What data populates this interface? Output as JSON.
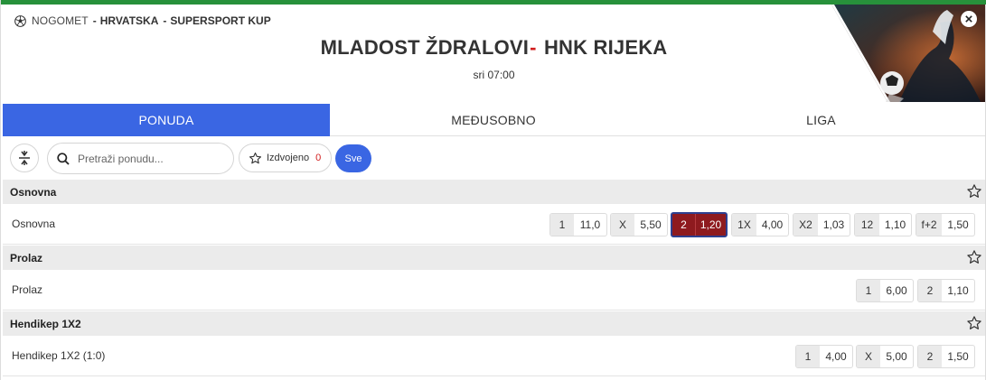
{
  "breadcrumb": {
    "sport": "NOGOMET",
    "country": "HRVATSKA",
    "competition": "SUPERSPORT KUP",
    "separator": "-"
  },
  "match": {
    "home": "MLADOST ŽDRALOVI",
    "dash": "-",
    "away": "HNK RIJEKA",
    "time": "sri 07:00"
  },
  "tabs": [
    {
      "label": "PONUDA",
      "active": true
    },
    {
      "label": "MEĐUSOBNO",
      "active": false
    },
    {
      "label": "LIGA",
      "active": false
    }
  ],
  "filters": {
    "search_placeholder": "Pretraži ponudu...",
    "favorites_label": "Izdvojeno",
    "favorites_count": "0",
    "all_label": "Sve"
  },
  "sections": [
    {
      "title": "Osnovna",
      "row_label": "Osnovna",
      "odds": [
        {
          "key": "1",
          "value": "11,0"
        },
        {
          "key": "X",
          "value": "5,50"
        },
        {
          "key": "2",
          "value": "1,20",
          "selected": true
        },
        {
          "key": "1X",
          "value": "4,00"
        },
        {
          "key": "X2",
          "value": "1,03"
        },
        {
          "key": "12",
          "value": "1,10"
        },
        {
          "key": "f+2",
          "value": "1,50"
        }
      ]
    },
    {
      "title": "Prolaz",
      "row_label": "Prolaz",
      "odds": [
        {
          "key": "1",
          "value": "6,00"
        },
        {
          "key": "2",
          "value": "1,10"
        }
      ]
    },
    {
      "title": "Hendikep 1X2",
      "row_label": "Hendikep 1X2 (1:0)",
      "odds": [
        {
          "key": "1",
          "value": "4,00"
        },
        {
          "key": "X",
          "value": "5,00"
        },
        {
          "key": "2",
          "value": "1,50"
        }
      ]
    }
  ],
  "colors": {
    "accent": "#3a66e3",
    "top_bar": "#27913b",
    "selected_odd": "#8e1a1f",
    "dash": "#d11d1d"
  },
  "icons": {
    "sport": "football-icon",
    "close": "close-icon",
    "collapse": "collapse-icon",
    "search": "search-icon",
    "favorite": "star-icon"
  }
}
